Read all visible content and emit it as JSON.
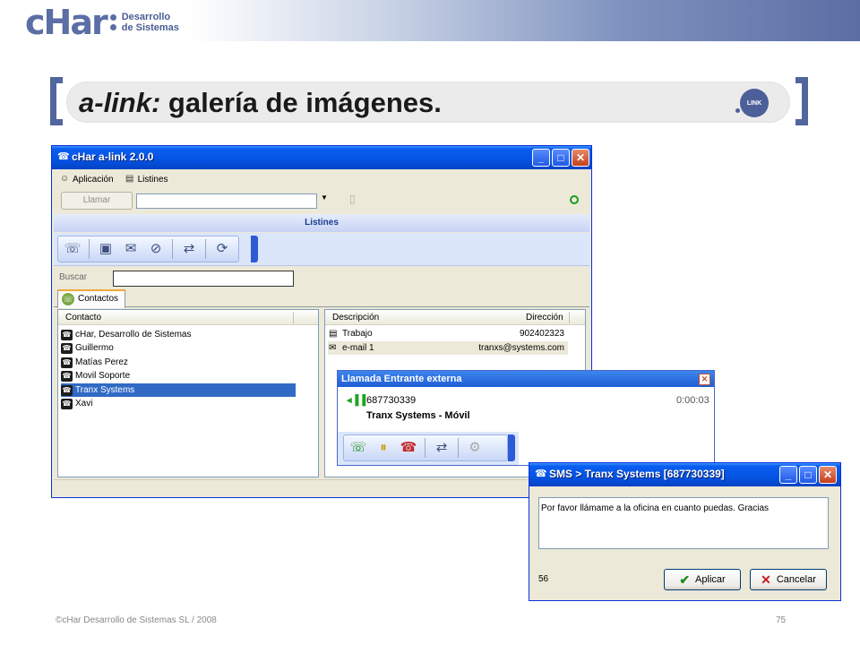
{
  "slide": {
    "brand_top": "Desarrollo",
    "brand_bottom": "de Sistemas",
    "logo_text": "cHar",
    "logo_link_text": "LINK",
    "title_italic": "a-link:",
    "title_rest": " galería de imágenes.",
    "footer_left": "©cHar Desarrollo de Sistemas SL / 2008",
    "page_number": "75"
  },
  "main_window": {
    "title": "cHar a-link 2.0.0",
    "menu": [
      {
        "label": "Aplicación",
        "icon": "app-icon"
      },
      {
        "label": "Listines",
        "icon": "book-icon"
      }
    ],
    "call_button": "Llamar",
    "section_title": "Listines",
    "search_label": "Buscar",
    "tab_label": "Contactos",
    "contacts_header": "Contacto",
    "contacts": [
      {
        "name": "cHar, Desarrollo de Sistemas",
        "selected": false
      },
      {
        "name": "Guillermo",
        "selected": false
      },
      {
        "name": "Matías Perez",
        "selected": false
      },
      {
        "name": "Movil Soporte",
        "selected": false
      },
      {
        "name": "Tranx Systems",
        "selected": true
      },
      {
        "name": "Xavi",
        "selected": false
      }
    ],
    "details_header_desc": "Descripción",
    "details_header_dir": "Dirección",
    "details": [
      {
        "desc": "Trabajo",
        "dir": "902402323",
        "icon": "phone-book-icon"
      },
      {
        "desc": "e-mail 1",
        "dir": "tranxs@systems.com",
        "icon": "envelope-icon"
      }
    ]
  },
  "call_window": {
    "title": "Llamada Entrante externa",
    "number": "687730339",
    "timer": "0:00:03",
    "caller": "Tranx Systems - Móvil"
  },
  "sms_window": {
    "title": "SMS  > Tranx Systems [687730339]",
    "message": "Por favor llámame a la oficina en cuanto puedas. Gracias",
    "char_count": "56",
    "apply_label": "Aplicar",
    "cancel_label": "Cancelar"
  },
  "colors": {
    "brand": "#5b6fa6",
    "xp_title": "#0553e3",
    "selection": "#316ac5"
  }
}
